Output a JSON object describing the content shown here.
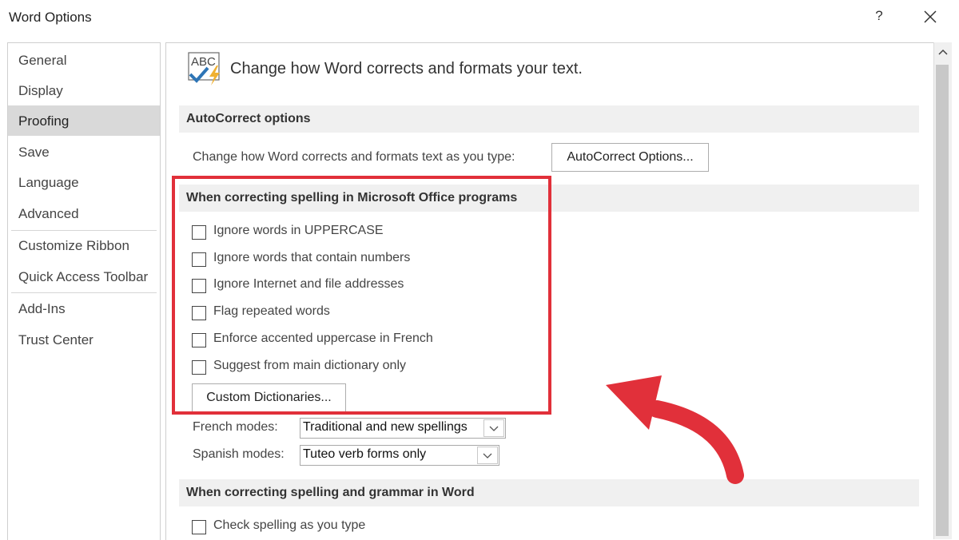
{
  "window": {
    "title": "Word Options",
    "help_label": "?"
  },
  "sidebar": {
    "items": [
      {
        "label": "General"
      },
      {
        "label": "Display"
      },
      {
        "label": "Proofing"
      },
      {
        "label": "Save"
      },
      {
        "label": "Language"
      },
      {
        "label": "Advanced"
      },
      {
        "label": "Customize Ribbon"
      },
      {
        "label": "Quick Access Toolbar"
      },
      {
        "label": "Add-Ins"
      },
      {
        "label": "Trust Center"
      }
    ],
    "selected": "Proofing"
  },
  "header": {
    "icon_text": "ABC",
    "text": "Change how Word corrects and formats your text."
  },
  "autocorrect": {
    "section_title": "AutoCorrect options",
    "description": "Change how Word corrects and formats text as you type:",
    "button_label": "AutoCorrect Options..."
  },
  "office_spelling": {
    "section_title": "When correcting spelling in Microsoft Office programs",
    "options": [
      {
        "label": "Ignore words in UPPERCASE",
        "checked": false
      },
      {
        "label": "Ignore words that contain numbers",
        "checked": false
      },
      {
        "label": "Ignore Internet and file addresses",
        "checked": false
      },
      {
        "label": "Flag repeated words",
        "checked": false
      },
      {
        "label": "Enforce accented uppercase in French",
        "checked": false
      },
      {
        "label": "Suggest from main dictionary only",
        "checked": false
      }
    ],
    "custom_dictionaries_label": "Custom Dictionaries...",
    "french_modes": {
      "label": "French modes:",
      "value": "Traditional and new spellings"
    },
    "spanish_modes": {
      "label": "Spanish modes:",
      "value": "Tuteo verb forms only"
    }
  },
  "word_spelling": {
    "section_title": "When correcting spelling and grammar in Word",
    "options": [
      {
        "label": "Check spelling as you type",
        "checked": false
      }
    ]
  },
  "annotation": {
    "highlight_color": "#e1303a",
    "arrow_color": "#e1303a"
  }
}
